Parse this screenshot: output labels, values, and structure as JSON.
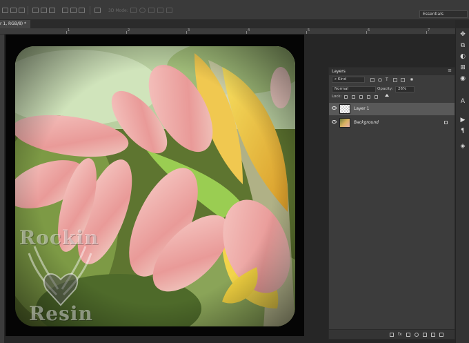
{
  "options_bar": {
    "mode_label": "3D Mode:",
    "workspace": "Essentials"
  },
  "document": {
    "tab_label": "r 1, RGB/8) *"
  },
  "ruler": {
    "ticks": [
      "1",
      "2",
      "3",
      "4",
      "5",
      "6",
      "7"
    ]
  },
  "canvas": {
    "watermark_line1": "Rockin",
    "watermark_line2": "Resin"
  },
  "layers_panel": {
    "title": "Layers",
    "filter_kind": "Kind",
    "blend_mode": "Normal",
    "opacity_label": "Opacity:",
    "opacity_value": "26%",
    "opacity_fraction": 0.26,
    "lock_label": "Lock:",
    "layers": [
      {
        "name": "Layer 1",
        "selected": true,
        "thumb": "transparent"
      },
      {
        "name": "Background",
        "selected": false,
        "thumb": "photo",
        "locked": true
      }
    ]
  },
  "icons": {
    "right_strip": [
      "move-icon",
      "history-icon",
      "info-icon",
      "adjust-icon",
      "color-icon",
      "type-icon",
      "play-icon",
      "paragraph-icon",
      "layers-icon"
    ]
  }
}
